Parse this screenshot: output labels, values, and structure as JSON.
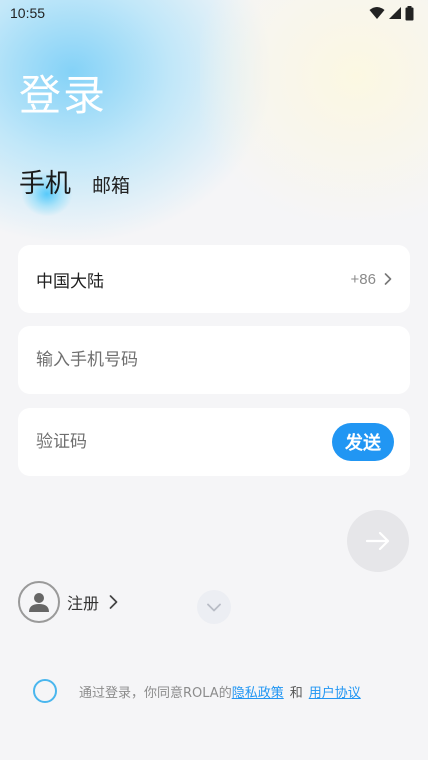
{
  "status_bar": {
    "time": "10:55"
  },
  "header": {
    "title": "登录"
  },
  "tabs": {
    "phone": "手机",
    "email": "邮箱"
  },
  "form": {
    "region": {
      "label": "中国大陆",
      "code": "+86"
    },
    "phone": {
      "placeholder": "输入手机号码",
      "value": ""
    },
    "code": {
      "placeholder": "验证码",
      "value": "",
      "send_label": "发送"
    }
  },
  "register": {
    "label": "注册"
  },
  "agreement": {
    "prefix": "通过登录，你同意ROLA的",
    "privacy_link": "隐私政策",
    "and": "和",
    "terms_link": "用户协议"
  },
  "colors": {
    "accent": "#2196f3",
    "radio_border": "#49b6ee",
    "card_bg": "#ffffff",
    "page_bg": "#f5f5f7"
  },
  "icons": {
    "wifi": "wifi-icon",
    "signal": "signal-icon",
    "battery": "battery-icon",
    "next": "arrow-right-icon",
    "avatar": "person-icon",
    "chevron": "chevron-right-icon",
    "collapse": "chevron-down-icon"
  }
}
